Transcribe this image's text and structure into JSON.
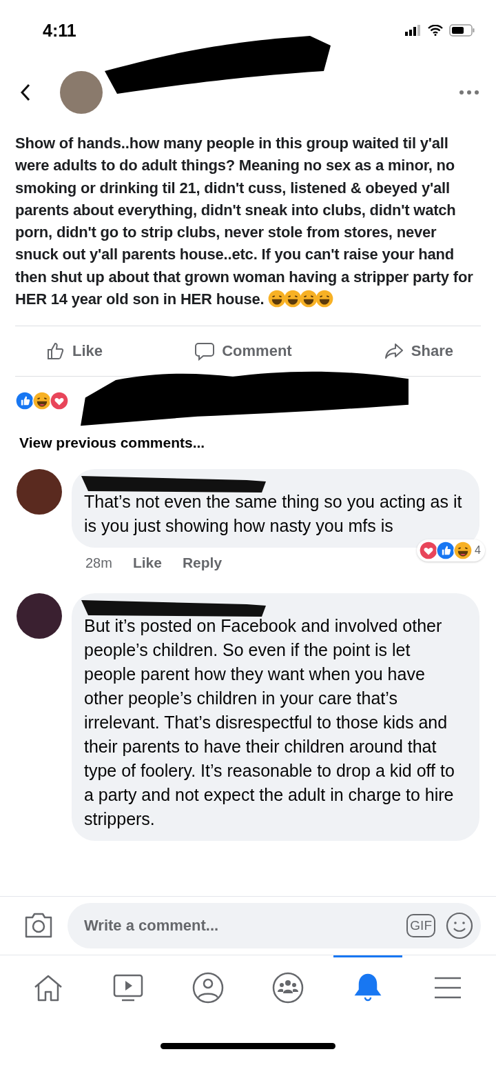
{
  "status_bar": {
    "time": "4:11"
  },
  "post": {
    "text": "Show of hands..how many people in this group waited til y'all were adults to do adult things? Meaning no sex as a minor, no smoking or drinking til 21, didn't cuss, listened & obeyed y'all parents about everything, didn't sneak into clubs, didn't watch porn, didn't go to strip clubs, never stole from stores, never snuck out y'all parents house..etc. If you can't raise your hand then shut up about that grown woman having a stripper party for HER 14 year old son in HER house.",
    "emojis": [
      {
        "kind": "laugh"
      },
      {
        "kind": "laugh"
      },
      {
        "kind": "laugh"
      },
      {
        "kind": "laugh"
      }
    ],
    "actions": [
      {
        "kind": "like",
        "label": "Like"
      },
      {
        "kind": "comment",
        "label": "Comment"
      },
      {
        "kind": "share",
        "label": "Share"
      }
    ],
    "reactions": [
      {
        "kind": "like"
      },
      {
        "kind": "laugh"
      },
      {
        "kind": "love"
      }
    ]
  },
  "view_previous": "View previous comments...",
  "comments": [
    {
      "text": "That’s not even the same thing so you acting as it is you just showing how nasty you mfs is",
      "time": "28m",
      "like": "Like",
      "reply": "Reply",
      "reactions": [
        {
          "kind": "love"
        },
        {
          "kind": "like"
        },
        {
          "kind": "laugh"
        }
      ],
      "reaction_count": "4"
    },
    {
      "text": " But it’s posted on Facebook and involved other people’s children. So even if the point is let people parent how they want when you have other people’s children in your care that’s irrelevant. That’s disrespectful to those kids and their parents to have their children around that type of foolery. It’s reasonable to drop a kid off to a party and not expect the adult in charge to hire strippers."
    }
  ],
  "composer": {
    "placeholder": "Write a comment...",
    "gif": "GIF"
  },
  "nav": [
    {
      "kind": "home",
      "selected": false
    },
    {
      "kind": "video",
      "selected": false
    },
    {
      "kind": "profile",
      "selected": false
    },
    {
      "kind": "groups",
      "selected": false
    },
    {
      "kind": "bell",
      "selected": true
    },
    {
      "kind": "menu",
      "selected": false
    }
  ]
}
